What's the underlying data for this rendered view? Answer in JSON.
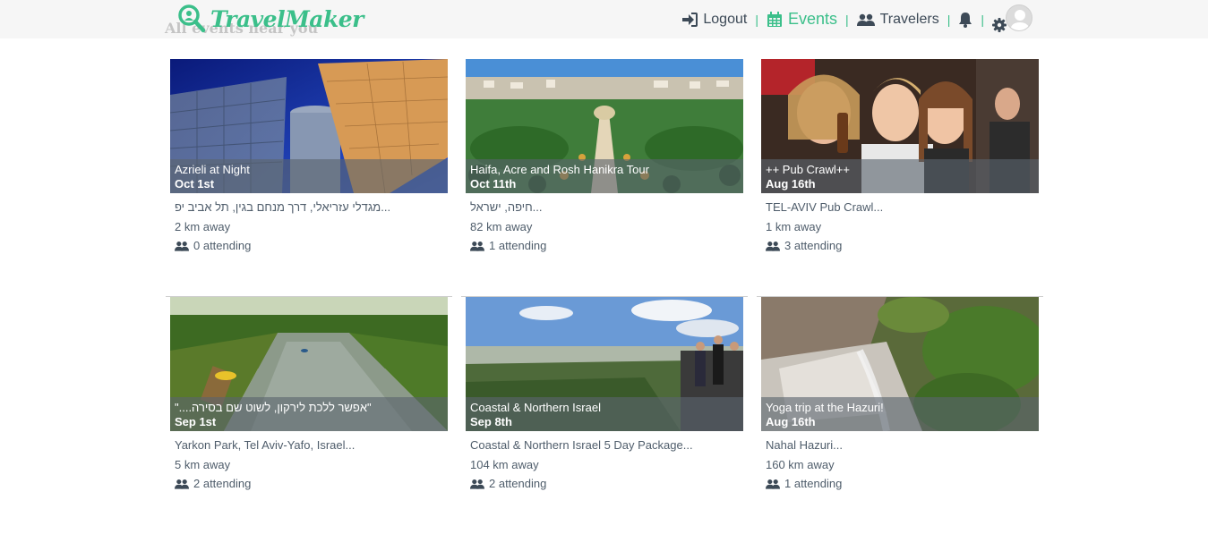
{
  "brand": {
    "name": "TravelMaker"
  },
  "page": {
    "heading": "All events near you"
  },
  "nav": {
    "logout_label": "Logout",
    "events_label": "Events",
    "travelers_label": "Travelers",
    "separator": "|"
  },
  "colors": {
    "accent": "#3bbf8a",
    "nav_text": "#3d4a57",
    "overlay": "#5a646e"
  },
  "events": [
    {
      "title": "Azrieli at Night",
      "date": "Oct 1st",
      "address": "מגדלי עזריאלי, דרך מנחם בגין, תל אביב יפ...",
      "distance": "2 km away",
      "attending": "0 attending"
    },
    {
      "title": "Haifa, Acre and Rosh Hanikra Tour",
      "date": "Oct 11th",
      "address": "חיפה, ישראל...",
      "distance": "82 km away",
      "attending": "1 attending"
    },
    {
      "title": "++ Pub Crawl++",
      "date": "Aug 16th",
      "address": "TEL-AVIV Pub Crawl...",
      "distance": "1 km away",
      "attending": "3 attending"
    },
    {
      "title": "\"אפשר ללכת לירקון, לשוט שם בסירה....\"",
      "date": "Sep 1st",
      "address": "Yarkon Park, Tel Aviv-Yafo, Israel...",
      "distance": "5 km away",
      "attending": "2 attending"
    },
    {
      "title": "Coastal & Northern Israel",
      "date": "Sep 8th",
      "address": "Coastal & Northern Israel 5 Day Package...",
      "distance": "104 km away",
      "attending": "2 attending"
    },
    {
      "title": "Yoga trip at the Hazuri!",
      "date": "Aug 16th",
      "address": "Nahal Hazuri...",
      "distance": "160 km away",
      "attending": "1 attending"
    }
  ]
}
